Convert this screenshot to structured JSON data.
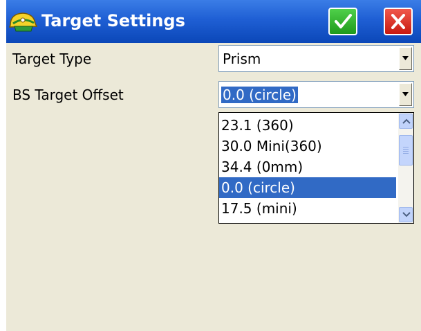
{
  "window": {
    "title": "Target Settings",
    "icon": "satellite-helmet-icon",
    "ok_icon": "checkmark-icon",
    "cancel_icon": "close-x-icon"
  },
  "fields": {
    "target_type": {
      "label": "Target Type",
      "value": "Prism"
    },
    "bs_target_offset": {
      "label": "BS Target Offset",
      "value": "0.0 (circle)"
    }
  },
  "dropdown": {
    "options": [
      "23.1 (360)",
      "30.0 Mini(360)",
      "34.4 (0mm)",
      "0.0 (circle)",
      "17.5 (mini)"
    ],
    "selected": "0.0 (circle)",
    "scroll_up_icon": "chevron-up-icon",
    "scroll_down_icon": "chevron-down-icon"
  },
  "colors": {
    "titlebar": "#1f5fd4",
    "ok": "#2ab526",
    "cancel": "#e0281c",
    "selection": "#316ac5"
  }
}
